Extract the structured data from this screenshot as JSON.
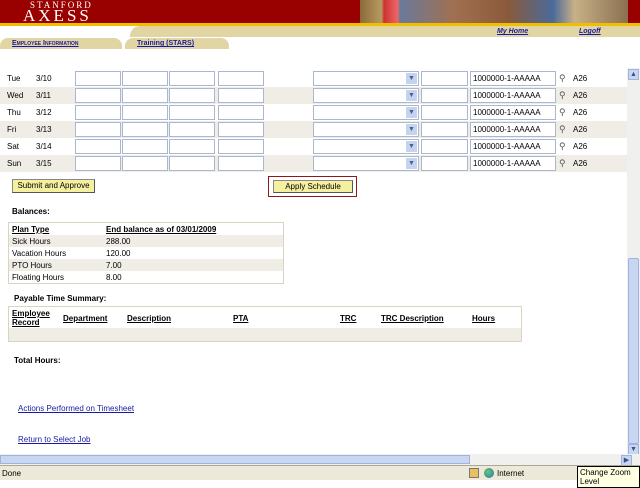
{
  "header": {
    "logo_top": "STANFORD",
    "logo_main": "AXESS",
    "links": {
      "home": "My Home",
      "logoff": "Logoff"
    }
  },
  "tabs": [
    {
      "label": "Employee Information"
    },
    {
      "label": "Training (STARS)"
    }
  ],
  "timesheet": {
    "rows": [
      {
        "day": "Tue",
        "date": "3/10",
        "pta": "1000000-1-AAAAA",
        "code": "A26"
      },
      {
        "day": "Wed",
        "date": "3/11",
        "pta": "1000000-1-AAAAA",
        "code": "A26"
      },
      {
        "day": "Thu",
        "date": "3/12",
        "pta": "1000000-1-AAAAA",
        "code": "A26"
      },
      {
        "day": "Fri",
        "date": "3/13",
        "pta": "1000000-1-AAAAA",
        "code": "A26"
      },
      {
        "day": "Sat",
        "date": "3/14",
        "pta": "1000000-1-AAAAA",
        "code": "A26"
      },
      {
        "day": "Sun",
        "date": "3/15",
        "pta": "1000000-1-AAAAA",
        "code": "A26"
      }
    ]
  },
  "buttons": {
    "submit": "Submit and Approve",
    "apply": "Apply Schedule"
  },
  "balances": {
    "title": "Balances:",
    "col1": "Plan Type",
    "col2": "End balance as of 03/01/2009",
    "rows": [
      {
        "plan": "Sick Hours",
        "value": "288.00"
      },
      {
        "plan": "Vacation Hours",
        "value": "120.00"
      },
      {
        "plan": "PTO Hours",
        "value": "7.00"
      },
      {
        "plan": "Floating Hours",
        "value": "8.00"
      }
    ]
  },
  "payable": {
    "title": "Payable Time Summary:",
    "columns": [
      "Employee Record",
      "Department",
      "Description",
      "PTA",
      "TRC",
      "TRC Description",
      "Hours"
    ]
  },
  "total_hours_label": "Total Hours:",
  "links": {
    "actions": "Actions Performed on Timesheet",
    "return": "Return to Select Job"
  },
  "statusbar": {
    "left": "Done",
    "zone": "Internet",
    "tooltip": "Change Zoom Level"
  }
}
